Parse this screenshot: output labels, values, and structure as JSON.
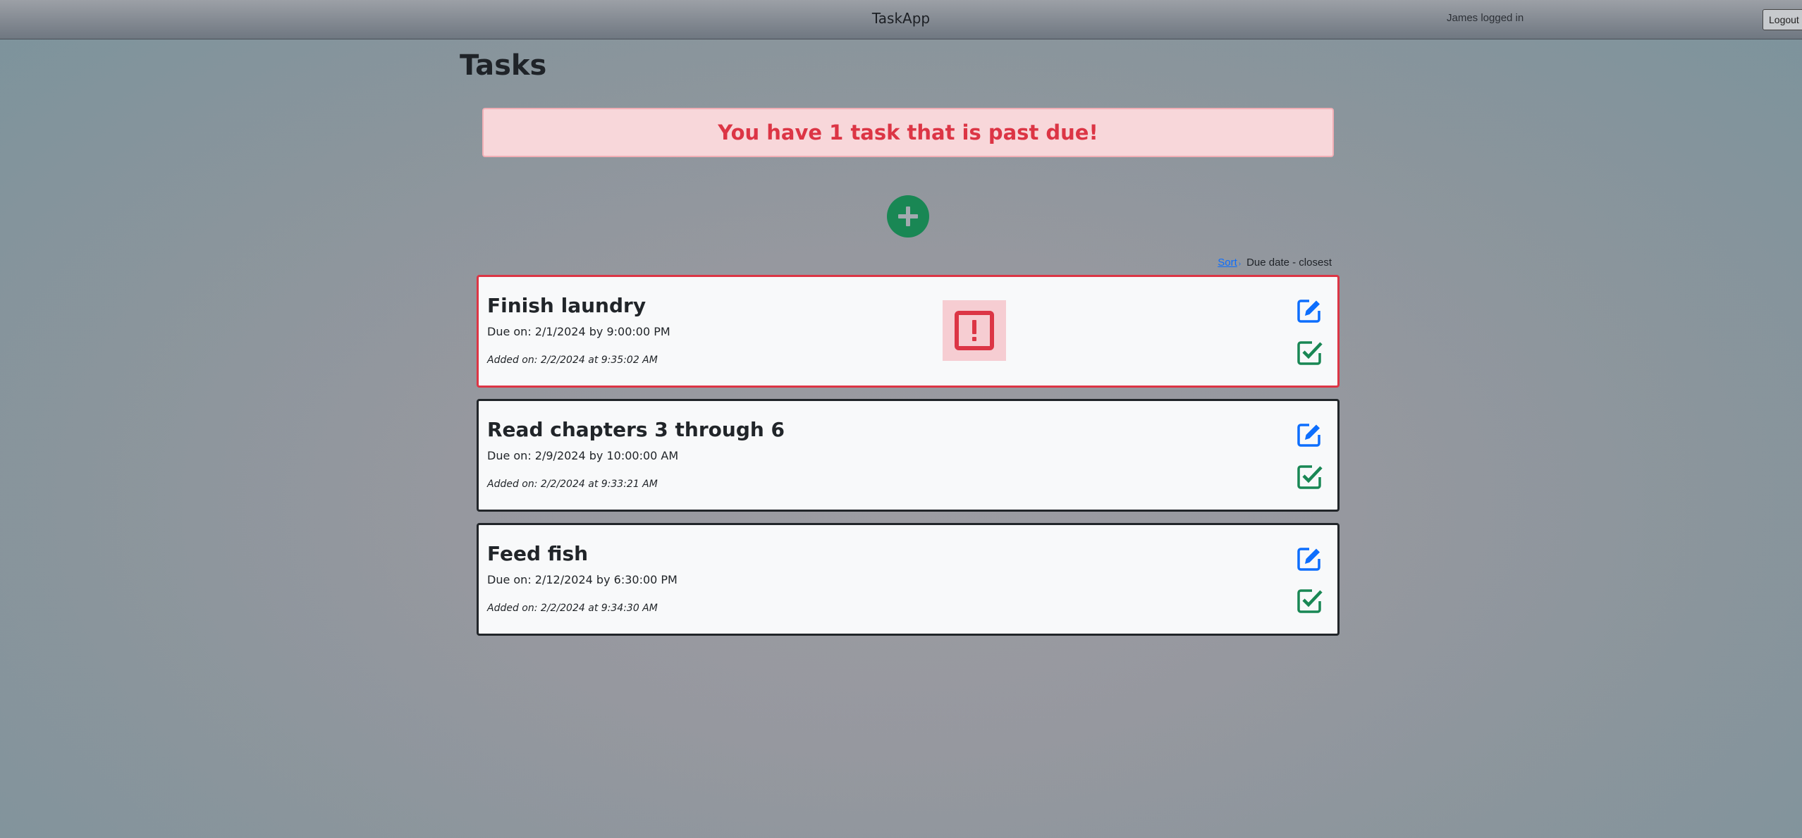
{
  "header": {
    "app_title": "TaskApp",
    "user_status": "James logged in",
    "logout_label": "Logout"
  },
  "page": {
    "title": "Tasks"
  },
  "alert": {
    "message": "You have 1 task that is past due!"
  },
  "sort": {
    "link_label": "Sort",
    "caret": "›",
    "current": "Due date - closest"
  },
  "tasks": [
    {
      "title": "Finish laundry",
      "due": "Due on: 2/1/2024 by 9:00:00 PM",
      "added": "Added on: 2/2/2024 at 9:35:02 AM",
      "past_due": true
    },
    {
      "title": "Read chapters 3 through 6",
      "due": "Due on: 2/9/2024 by 10:00:00 AM",
      "added": "Added on: 2/2/2024 at 9:33:21 AM",
      "past_due": false
    },
    {
      "title": "Feed fish",
      "due": "Due on: 2/12/2024 by 6:30:00 PM",
      "added": "Added on: 2/2/2024 at 9:34:30 AM",
      "past_due": false
    }
  ],
  "colors": {
    "danger": "#dc3545",
    "success": "#198754",
    "primary": "#0d6efd"
  },
  "icons": {
    "add": "plus-circle-icon",
    "edit": "pencil-square-icon",
    "complete": "check-square-icon",
    "warning": "exclamation-square-icon"
  }
}
